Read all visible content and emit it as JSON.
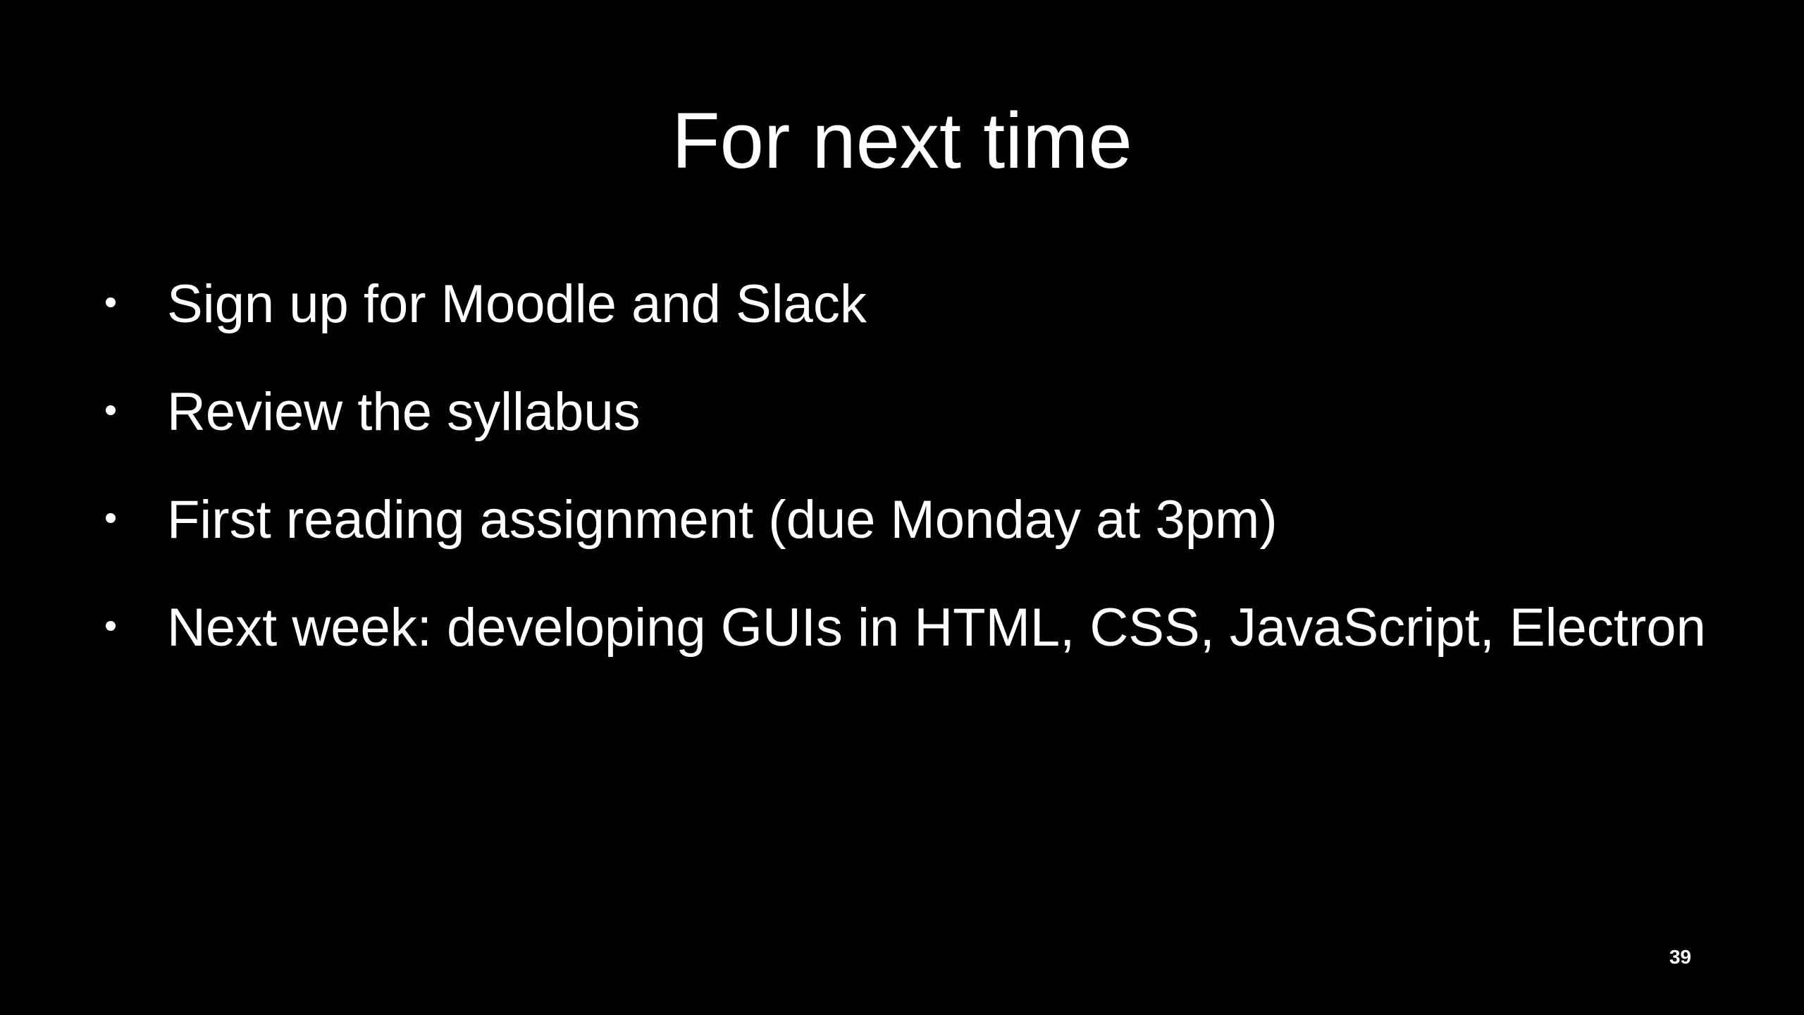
{
  "slide": {
    "title": "For next time",
    "bullets": [
      "Sign up for Moodle and Slack",
      "Review the syllabus",
      "First reading assignment (due Monday at 3pm)",
      "Next week: developing GUIs in HTML, CSS, JavaScript, Electron"
    ],
    "page_number": "39"
  },
  "colors": {
    "background": "#000000",
    "text": "#ffffff"
  }
}
